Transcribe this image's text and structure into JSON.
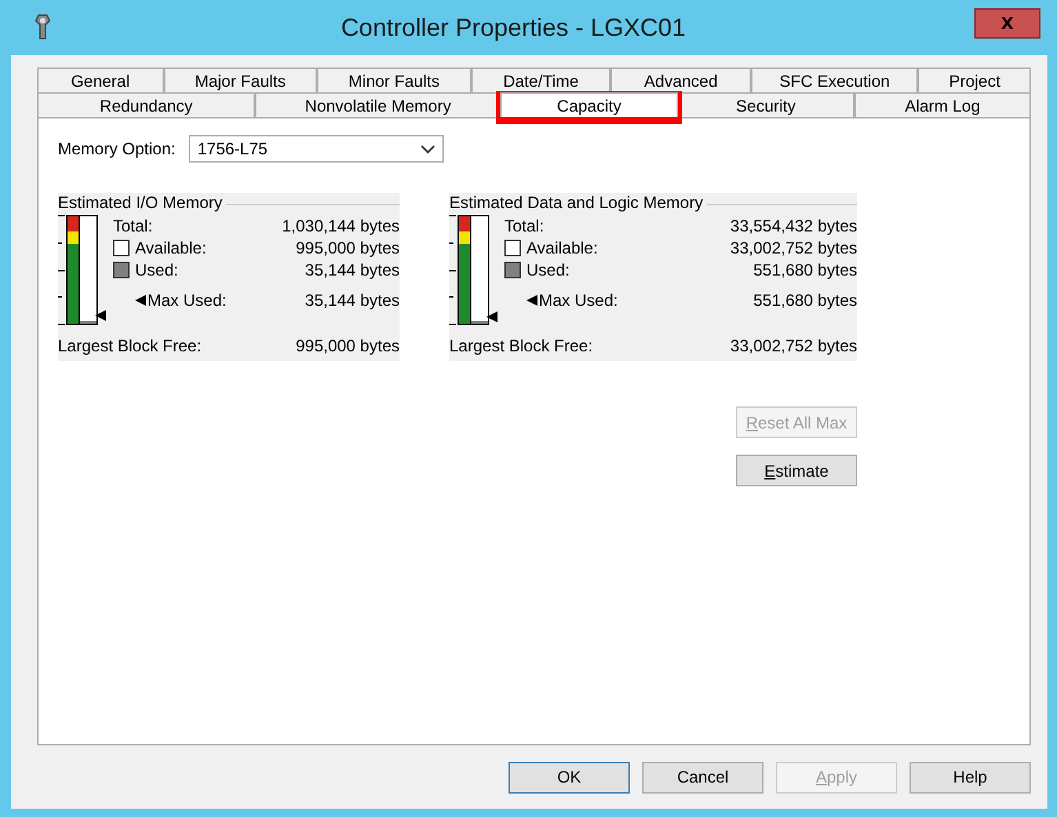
{
  "window": {
    "title": "Controller Properties - LGXC01",
    "close": "x"
  },
  "tab_rows": [
    [
      {
        "label": "General",
        "selected": false
      },
      {
        "label": "Major Faults",
        "selected": false
      },
      {
        "label": "Minor Faults",
        "selected": false
      },
      {
        "label": "Date/Time",
        "selected": false
      },
      {
        "label": "Advanced",
        "selected": false
      },
      {
        "label": "SFC Execution",
        "selected": false
      },
      {
        "label": "Project",
        "selected": false
      }
    ],
    [
      {
        "label": "Redundancy",
        "selected": false
      },
      {
        "label": "Nonvolatile Memory",
        "selected": false
      },
      {
        "label": "Capacity",
        "selected": true,
        "highlighted": true
      },
      {
        "label": "Security",
        "selected": false
      },
      {
        "label": "Alarm Log",
        "selected": false
      }
    ]
  ],
  "memory_option": {
    "label": "Memory Option:",
    "value": "1756-L75"
  },
  "groups": [
    {
      "title": "Estimated I/O Memory",
      "level": 0.03,
      "total_label": "Total:",
      "total": "1,030,144 bytes",
      "available_label": "Available:",
      "available": "995,000 bytes",
      "used_label": "Used:",
      "used": "35,144 bytes",
      "max_label": "Max Used:",
      "max": "35,144 bytes",
      "largest_label": "Largest Block Free:",
      "largest": "995,000 bytes"
    },
    {
      "title": "Estimated Data and Logic Memory",
      "level": 0.02,
      "total_label": "Total:",
      "total": "33,554,432 bytes",
      "available_label": "Available:",
      "available": "33,002,752 bytes",
      "used_label": "Used:",
      "used": "551,680 bytes",
      "max_label": "Max Used:",
      "max": "551,680 bytes",
      "largest_label": "Largest Block Free:",
      "largest": "33,002,752 bytes"
    }
  ],
  "side_buttons": [
    {
      "label": "Reset All Max",
      "disabled": true
    },
    {
      "label": "Estimate",
      "disabled": false
    }
  ],
  "footer_buttons": [
    {
      "label": "OK",
      "disabled": false,
      "default": true
    },
    {
      "label": "Cancel",
      "disabled": false,
      "default": false
    },
    {
      "label": "Apply",
      "disabled": true,
      "default": false
    },
    {
      "label": "Help",
      "disabled": false,
      "default": false
    }
  ]
}
